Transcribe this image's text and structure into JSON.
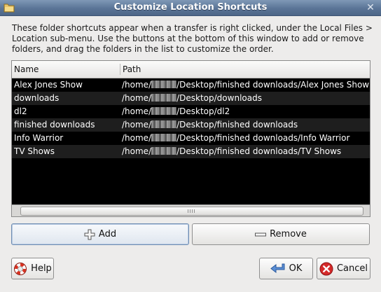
{
  "window": {
    "title": "Customize Location Shortcuts",
    "close_glyph": "✕"
  },
  "description": "These folder shortcuts appear when a transfer is right clicked, under the Local Files > Location sub-menu.  Use the buttons at the bottom of this window to add or remove folders, and drag the folders in the list to customize the order.",
  "list": {
    "columns": [
      "Name",
      "Path"
    ],
    "rows": [
      {
        "name": "Alex Jones Show",
        "path_prefix": "/home/",
        "path_suffix": "/Desktop/finished downloads/Alex Jones Show"
      },
      {
        "name": "downloads",
        "path_prefix": "/home/",
        "path_suffix": "/Desktop/downloads"
      },
      {
        "name": "dl2",
        "path_prefix": "/home/",
        "path_suffix": "/Desktop/dl2"
      },
      {
        "name": "finished downloads",
        "path_prefix": "/home/",
        "path_suffix": "/Desktop/finished downloads"
      },
      {
        "name": "Info Warrior",
        "path_prefix": "/home/",
        "path_suffix": "/Desktop/finished downloads/Info Warrior"
      },
      {
        "name": "TV Shows",
        "path_prefix": "/home/",
        "path_suffix": "/Desktop/finished downloads/TV Shows"
      }
    ]
  },
  "buttons": {
    "add": "Add",
    "remove": "Remove",
    "help": "Help",
    "ok": "OK",
    "cancel": "Cancel"
  },
  "colors": {
    "titlebar": "#5a7496",
    "list_bg": "#000000",
    "list_text": "#ffffff",
    "help_ring": "#d9301f",
    "ok_arrow": "#3d6fb8",
    "cancel_red": "#cc1f1f"
  },
  "icons": [
    "folder-icon",
    "close-icon",
    "plus-icon",
    "minus-icon",
    "help-lifebuoy-icon",
    "ok-arrow-icon",
    "cancel-icon"
  ]
}
